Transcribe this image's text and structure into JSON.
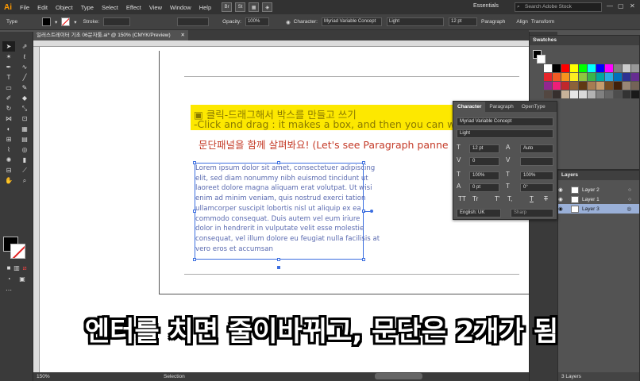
{
  "app": {
    "logo": "Ai"
  },
  "menu": [
    "File",
    "Edit",
    "Object",
    "Type",
    "Select",
    "Effect",
    "View",
    "Window",
    "Help"
  ],
  "menu_tiles": [
    "Br",
    "St"
  ],
  "workspace": {
    "label": "Essentials",
    "search_placeholder": "Search Adobe Stock"
  },
  "control_bar": {
    "type_label": "Type",
    "stroke_label": "Stroke:",
    "opacity_label": "Opacity:",
    "opacity_value": "100%",
    "character_label": "Character:",
    "font": "Myriad Variable Concept",
    "style": "Light",
    "size": "12 pt",
    "paragraph_label": "Paragraph",
    "align_label": "Align",
    "transform_label": "Transform"
  },
  "document": {
    "tab": "일러스트레이터 기초 06문자툴.ai* @ 150% (CMYK/Preview)"
  },
  "artboard": {
    "heading_1": "▣ 클릭-드래그해서 박스를 만들고 쓰기",
    "heading_2": "-Click and drag : it makes a box, and then you can w",
    "heading_3": "문단패널을 함께 살펴봐요! (Let's see Paragraph panne",
    "body_lines": [
      "Lorem ipsum dolor sit amet, consectetuer adipiscing",
      "elit, sed diam nonummy nibh euismod tincidunt ut",
      "laoreet dolore magna aliquam erat volutpat. Ut wisi",
      "enim ad minim veniam, quis nostrud exerci tation",
      "ullamcorper suscipit lobortis nisl ut aliquip ex ea",
      "commodo consequat. Duis autem vel eum iriure",
      "dolor in hendrerit in vulputate velit esse molestie",
      "consequat, vel illum dolore eu feugiat nulla facilisis at",
      "vero eros et accumsan"
    ]
  },
  "caption": "엔터를 치면 줄이바뀌고, 문단은 2개가 됨",
  "status": {
    "zoom": "150%",
    "tool": "Selection",
    "layers_count": "3 Layers"
  },
  "swatches_panel": {
    "title": "Swatches",
    "colors": [
      "#ffffff",
      "#000000",
      "#ff0000",
      "#ffff00",
      "#00ff00",
      "#00ffff",
      "#0000ff",
      "#ff00ff",
      "#7f7f7f",
      "#cccccc",
      "#999999",
      "#e8262b",
      "#f15a24",
      "#f7931e",
      "#fcee21",
      "#8cc63f",
      "#39b54a",
      "#00a99d",
      "#29abe2",
      "#0071bc",
      "#2e3192",
      "#662d91",
      "#93278f",
      "#ed1e79",
      "#c1272d",
      "#8c6239",
      "#603813",
      "#a67c52",
      "#c69c6d",
      "#754c24",
      "#42210b",
      "#998675",
      "#736357",
      "#534741",
      "#362f2d",
      "#c7b299",
      "#e6e6e6",
      "#d9d9d9",
      "#b3b3b3",
      "#808080",
      "#666666",
      "#4d4d4d",
      "#333333",
      "#1a1a1a"
    ]
  },
  "layers_panel": {
    "title": "Layers",
    "layers": [
      {
        "name": "Layer 2"
      },
      {
        "name": "Layer 1"
      },
      {
        "name": "Layer 3"
      }
    ]
  },
  "character_panel": {
    "tabs": [
      "Character",
      "Paragraph",
      "OpenType"
    ],
    "font": "Myriad Variable Concept",
    "style": "Light",
    "size": "12 pt",
    "leading": "Auto",
    "kerning": "0",
    "tracking": "",
    "vscale": "100%",
    "hscale": "100%",
    "baseline": "0 pt",
    "rotation": "0°",
    "language": "English: UK",
    "antialias": "Sharp",
    "glyph_buttons": [
      "TT",
      "Tr",
      "T'",
      "T,",
      "T",
      "T"
    ]
  }
}
